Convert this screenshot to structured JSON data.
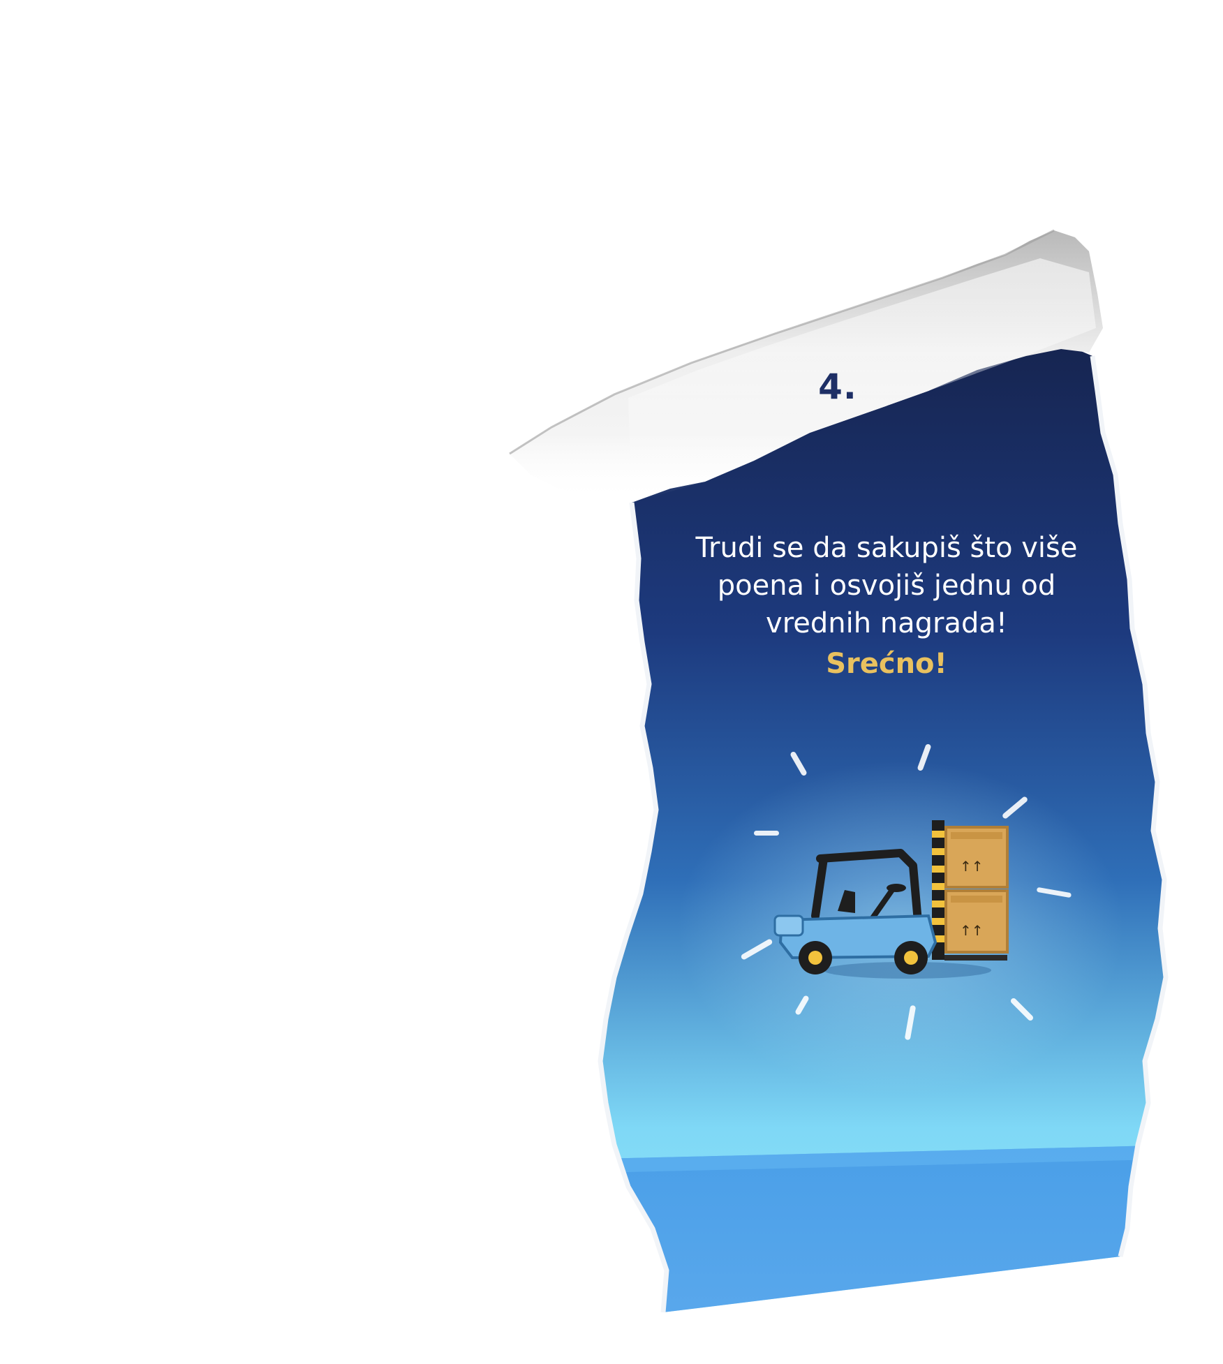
{
  "card": {
    "step_number": "4.",
    "instruction_lines": [
      "Trudi se da sakupiš što više",
      "poena i osvojiš jednu od",
      "vrednih nagrada!"
    ],
    "luck_text": "Srećno!"
  },
  "colors": {
    "background": "#ffffff",
    "panel_top": "#16244f",
    "panel_mid": "#2a5aa8",
    "panel_bottom": "#8fe4fb",
    "floor": "#4a9fe8",
    "step_number": "#1e2f66",
    "luck_text": "#e9c15f",
    "forklift_body": "#6eb4e6",
    "box": "#d9a658"
  },
  "icons": {
    "illustration": "forklift-with-boxes-icon"
  }
}
